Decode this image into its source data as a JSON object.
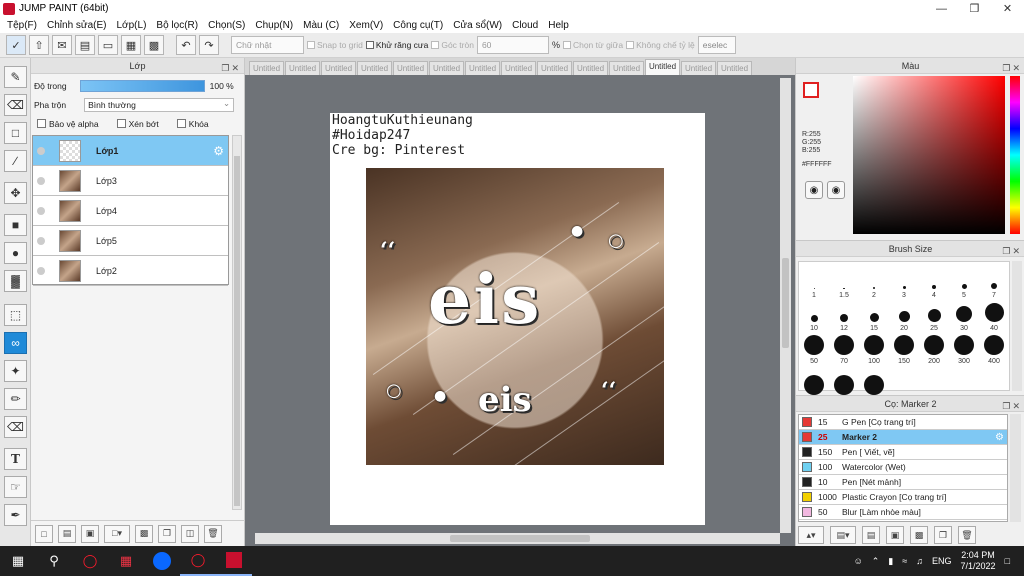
{
  "window": {
    "title": "JUMP PAINT (64bit)"
  },
  "menu": [
    "Tệp(F)",
    "Chỉnh sửa(E)",
    "Lớp(L)",
    "Bộ lọc(R)",
    "Chọn(S)",
    "Chụp(N)",
    "Màu (C)",
    "Xem(V)",
    "Công cụ(T)",
    "Cửa sổ(W)",
    "Cloud",
    "Help"
  ],
  "toolbar": {
    "shape": "Chữ nhật",
    "snap_grid": "Snap to grid",
    "antialias": "Khử răng cưa",
    "rounded": "Góc tròn",
    "rounded_value": "60",
    "percent": "%",
    "from_center": "Chọn từ giữa",
    "fixed_ratio": "Không chế tỷ lệ",
    "deselect": "eselec"
  },
  "layer_panel": {
    "title": "Lớp",
    "opacity_label": "Độ trong",
    "opacity_value": "100 %",
    "opacity": 1.0,
    "blend_label": "Pha trộn",
    "blend_value": "Bình thường",
    "protect_alpha": "Bảo vệ alpha",
    "clip": "Xén bớt",
    "lock": "Khóa",
    "layers": [
      "Lớp1",
      "Lớp3",
      "Lớp4",
      "Lớp5",
      "Lớp2"
    ]
  },
  "tabs": [
    "Untitled",
    "Untitled",
    "Untitled",
    "Untitled",
    "Untitled",
    "Untitled",
    "Untitled",
    "Untitled",
    "Untitled",
    "Untitled",
    "Untitled",
    "Untitled",
    "Untitled",
    "Untitled"
  ],
  "active_tab_index": 11,
  "canvas": {
    "lines": [
      "HoangtuKuthieunang",
      "#Hoidap247",
      "Cre bg: Pinterest"
    ],
    "lettering_big": "eis",
    "lettering_small": "eis"
  },
  "color_panel": {
    "title": "Màu",
    "r": "R:255",
    "g": "G:255",
    "b": "B:255",
    "hex": "#FFFFFF",
    "fg_color": "#e02020"
  },
  "brush_panel": {
    "title": "Brush Size",
    "sizes": [
      "1",
      "1.5",
      "2",
      "3",
      "4",
      "5",
      "7",
      "10",
      "12",
      "15",
      "20",
      "25",
      "30",
      "40",
      "50",
      "70",
      "100",
      "150",
      "200",
      "300",
      "400",
      "",
      "",
      ""
    ]
  },
  "marker_panel": {
    "title": "Cọ: Marker 2",
    "items": [
      {
        "size": "15",
        "name": "G Pen [Cọ trang trí]",
        "color": "#e53935"
      },
      {
        "size": "25",
        "name": "Marker 2",
        "color": "#e53935"
      },
      {
        "size": "150",
        "name": "Pen [ Viết, vẽ]",
        "color": "#222222"
      },
      {
        "size": "100",
        "name": "Watercolor (Wet)",
        "color": "#6fd0f0"
      },
      {
        "size": "10",
        "name": "Pen [Nét mảnh]",
        "color": "#222222"
      },
      {
        "size": "1000",
        "name": "Plastic Crayon [Cọ trang trí]",
        "color": "#f2d000"
      },
      {
        "size": "50",
        "name": "Blur [Làm nhòe màu]",
        "color": "#f2b8e0"
      }
    ]
  },
  "taskbar": {
    "lang": "ENG",
    "time": "2:04 PM",
    "date": "7/1/2022"
  }
}
